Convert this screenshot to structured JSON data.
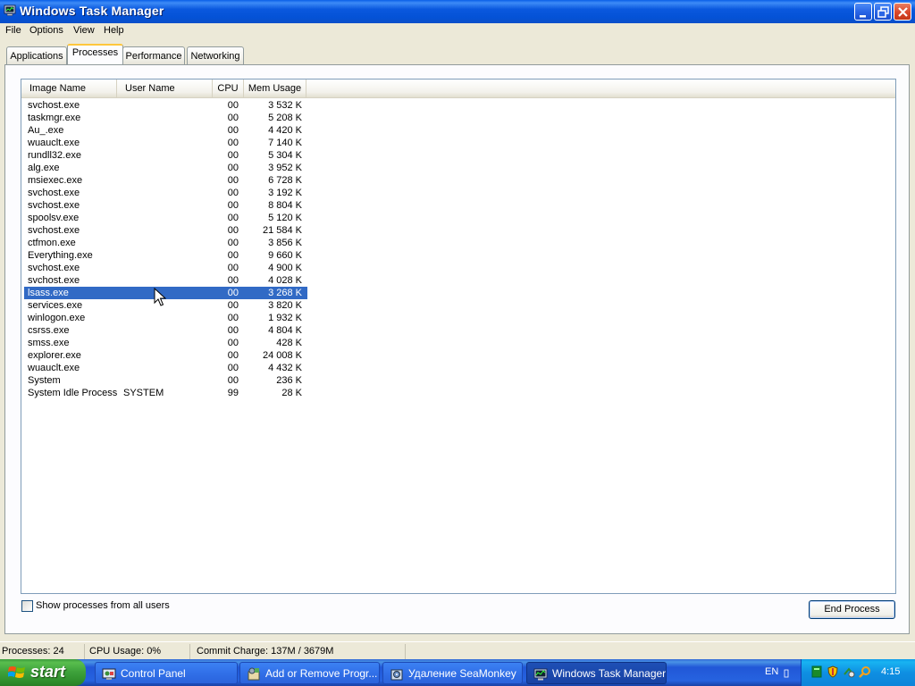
{
  "window": {
    "title": "Windows Task Manager"
  },
  "menu": [
    "File",
    "Options",
    "View",
    "Help"
  ],
  "tabs": [
    "Applications",
    "Processes",
    "Performance",
    "Networking"
  ],
  "active_tab": "Processes",
  "columns": [
    "Image Name",
    "User Name",
    "CPU",
    "Mem Usage"
  ],
  "processes": [
    {
      "name": "svchost.exe",
      "user": "",
      "cpu": "00",
      "mem": "3 532 K"
    },
    {
      "name": "taskmgr.exe",
      "user": "",
      "cpu": "00",
      "mem": "5 208 K"
    },
    {
      "name": "Au_.exe",
      "user": "",
      "cpu": "00",
      "mem": "4 420 K"
    },
    {
      "name": "wuauclt.exe",
      "user": "",
      "cpu": "00",
      "mem": "7 140 K"
    },
    {
      "name": "rundll32.exe",
      "user": "",
      "cpu": "00",
      "mem": "5 304 K"
    },
    {
      "name": "alg.exe",
      "user": "",
      "cpu": "00",
      "mem": "3 952 K"
    },
    {
      "name": "msiexec.exe",
      "user": "",
      "cpu": "00",
      "mem": "6 728 K"
    },
    {
      "name": "svchost.exe",
      "user": "",
      "cpu": "00",
      "mem": "3 192 K"
    },
    {
      "name": "svchost.exe",
      "user": "",
      "cpu": "00",
      "mem": "8 804 K"
    },
    {
      "name": "spoolsv.exe",
      "user": "",
      "cpu": "00",
      "mem": "5 120 K"
    },
    {
      "name": "svchost.exe",
      "user": "",
      "cpu": "00",
      "mem": "21 584 K"
    },
    {
      "name": "ctfmon.exe",
      "user": "",
      "cpu": "00",
      "mem": "3 856 K"
    },
    {
      "name": "Everything.exe",
      "user": "",
      "cpu": "00",
      "mem": "9 660 K"
    },
    {
      "name": "svchost.exe",
      "user": "",
      "cpu": "00",
      "mem": "4 900 K"
    },
    {
      "name": "svchost.exe",
      "user": "",
      "cpu": "00",
      "mem": "4 028 K"
    },
    {
      "name": "lsass.exe",
      "user": "",
      "cpu": "00",
      "mem": "3 268 K",
      "selected": true
    },
    {
      "name": "services.exe",
      "user": "",
      "cpu": "00",
      "mem": "3 820 K"
    },
    {
      "name": "winlogon.exe",
      "user": "",
      "cpu": "00",
      "mem": "1 932 K"
    },
    {
      "name": "csrss.exe",
      "user": "",
      "cpu": "00",
      "mem": "4 804 K"
    },
    {
      "name": "smss.exe",
      "user": "",
      "cpu": "00",
      "mem": "428 K"
    },
    {
      "name": "explorer.exe",
      "user": "",
      "cpu": "00",
      "mem": "24 008 K"
    },
    {
      "name": "wuauclt.exe",
      "user": "",
      "cpu": "00",
      "mem": "4 432 K"
    },
    {
      "name": "System",
      "user": "",
      "cpu": "00",
      "mem": "236 K"
    },
    {
      "name": "System Idle Process",
      "user": "SYSTEM",
      "cpu": "99",
      "mem": "28 K"
    }
  ],
  "show_all_users_label": "Show processes from all users",
  "end_process_label": "End Process",
  "status": {
    "processes": "Processes: 24",
    "cpu": "CPU Usage: 0%",
    "commit": "Commit Charge: 137M / 3679M"
  },
  "taskbar": {
    "start_label": "start",
    "tasks": [
      {
        "label": "Control Panel",
        "icon": "control-panel-icon"
      },
      {
        "label": "Add or Remove Progr...",
        "icon": "add-remove-programs-icon"
      },
      {
        "label": "Удаление SeaMonkey",
        "icon": "setup-icon"
      },
      {
        "label": "Windows Task Manager",
        "icon": "task-manager-icon",
        "active": true
      }
    ],
    "language": "EN",
    "clock": "4:15"
  },
  "colors": {
    "selection": "#316AC5",
    "titlebar": "#0A58DE",
    "start_green": "#3FA33C"
  }
}
